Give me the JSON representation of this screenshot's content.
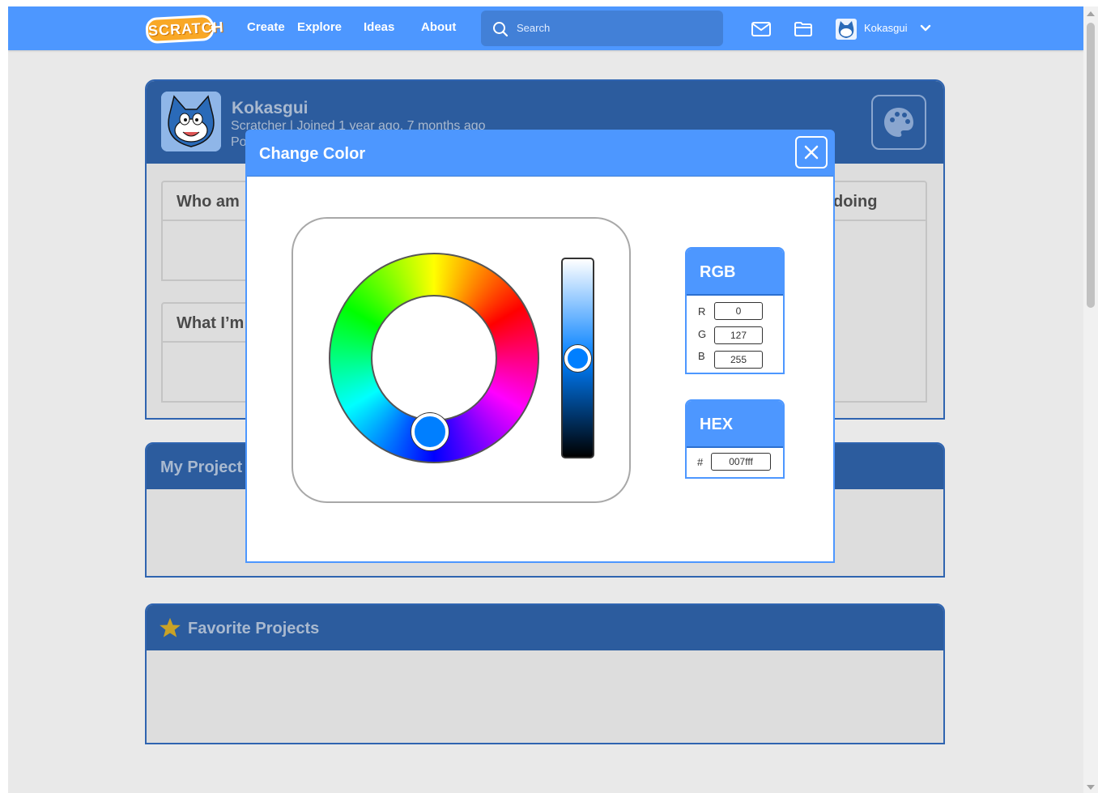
{
  "nav": {
    "logo": "SCRATCH",
    "links": [
      "Create",
      "Explore",
      "Ideas",
      "About"
    ],
    "search_placeholder": "Search",
    "username": "Kokasgui"
  },
  "profile": {
    "name": "Kokasgui",
    "subtitle": "Scratcher | Joined 1 year ago, 7 months ago",
    "subtitle2": "Po",
    "box_about": "Who am",
    "box_working": "What I’m",
    "box_right": "doing"
  },
  "sections": {
    "my_projects": "My Project",
    "favorite_projects": "Favorite Projects"
  },
  "modal": {
    "title": "Change Color",
    "rgb_title": "RGB",
    "r_label": "R",
    "g_label": "G",
    "b_label": "B",
    "r_value": "0",
    "g_value": "127",
    "b_value": "255",
    "hex_title": "HEX",
    "hex_label": "#",
    "hex_value": "007fff",
    "brightness_fraction": 0.5
  },
  "colors": {
    "nav_blue": "#4d97ff",
    "card_blue": "#2c5c9e",
    "selected_color": "#007fff"
  }
}
